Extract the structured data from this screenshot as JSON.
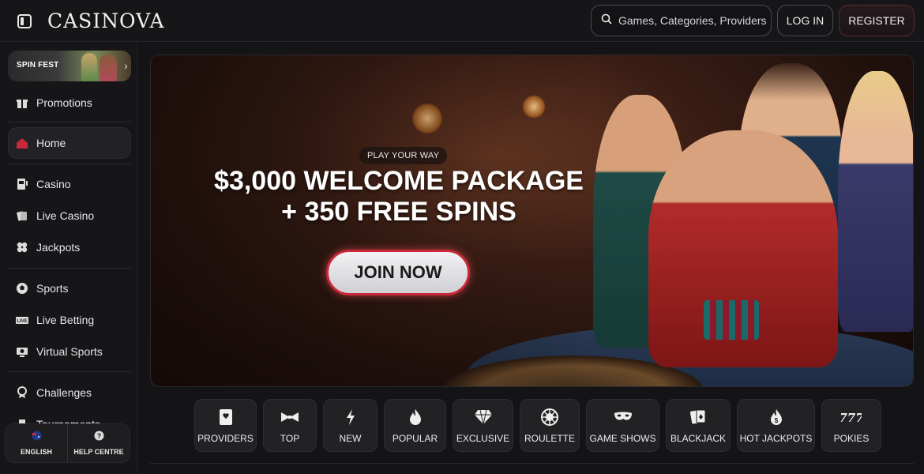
{
  "app": {
    "logo": "CASINOVA"
  },
  "header": {
    "search_placeholder": "Games, Categories, Providers",
    "login_label": "LOG IN",
    "register_label": "REGISTER"
  },
  "sidebar": {
    "promo_banner": "SPIN FEST",
    "items": [
      {
        "label": "Promotions",
        "icon": "gift-icon"
      },
      {
        "label": "Home",
        "icon": "home-icon",
        "active": true
      },
      {
        "label": "Casino",
        "icon": "slot-machine-icon"
      },
      {
        "label": "Live Casino",
        "icon": "cards-icon"
      },
      {
        "label": "Jackpots",
        "icon": "clover-icon"
      },
      {
        "label": "Sports",
        "icon": "soccer-ball-icon"
      },
      {
        "label": "Live Betting",
        "icon": "live-badge-icon"
      },
      {
        "label": "Virtual Sports",
        "icon": "virtual-sports-icon"
      },
      {
        "label": "Challenges",
        "icon": "medal-icon"
      },
      {
        "label": "Tournaments",
        "icon": "trophy-icon"
      }
    ],
    "footer": {
      "language": "ENGLISH",
      "help": "HELP CENTRE"
    }
  },
  "hero": {
    "tag": "PLAY YOUR WAY",
    "title_line1": "$3,000 WELCOME PACKAGE",
    "title_line2": "+ 350 FREE SPINS",
    "cta": "JOIN NOW"
  },
  "categories": [
    {
      "label": "PROVIDERS",
      "icon": "providers-icon"
    },
    {
      "label": "TOP",
      "icon": "bowtie-icon"
    },
    {
      "label": "NEW",
      "icon": "lightning-icon"
    },
    {
      "label": "POPULAR",
      "icon": "flame-icon"
    },
    {
      "label": "EXCLUSIVE",
      "icon": "diamond-icon"
    },
    {
      "label": "ROULETTE",
      "icon": "roulette-icon"
    },
    {
      "label": "GAME SHOWS",
      "icon": "mask-icon"
    },
    {
      "label": "BLACKJACK",
      "icon": "playing-cards-icon"
    },
    {
      "label": "HOT JACKPOTS",
      "icon": "hot-jackpot-icon"
    },
    {
      "label": "POKIES",
      "icon": "777-icon"
    }
  ],
  "colors": {
    "accent": "#c9283a",
    "background": "#141416",
    "panel": "#222225"
  }
}
